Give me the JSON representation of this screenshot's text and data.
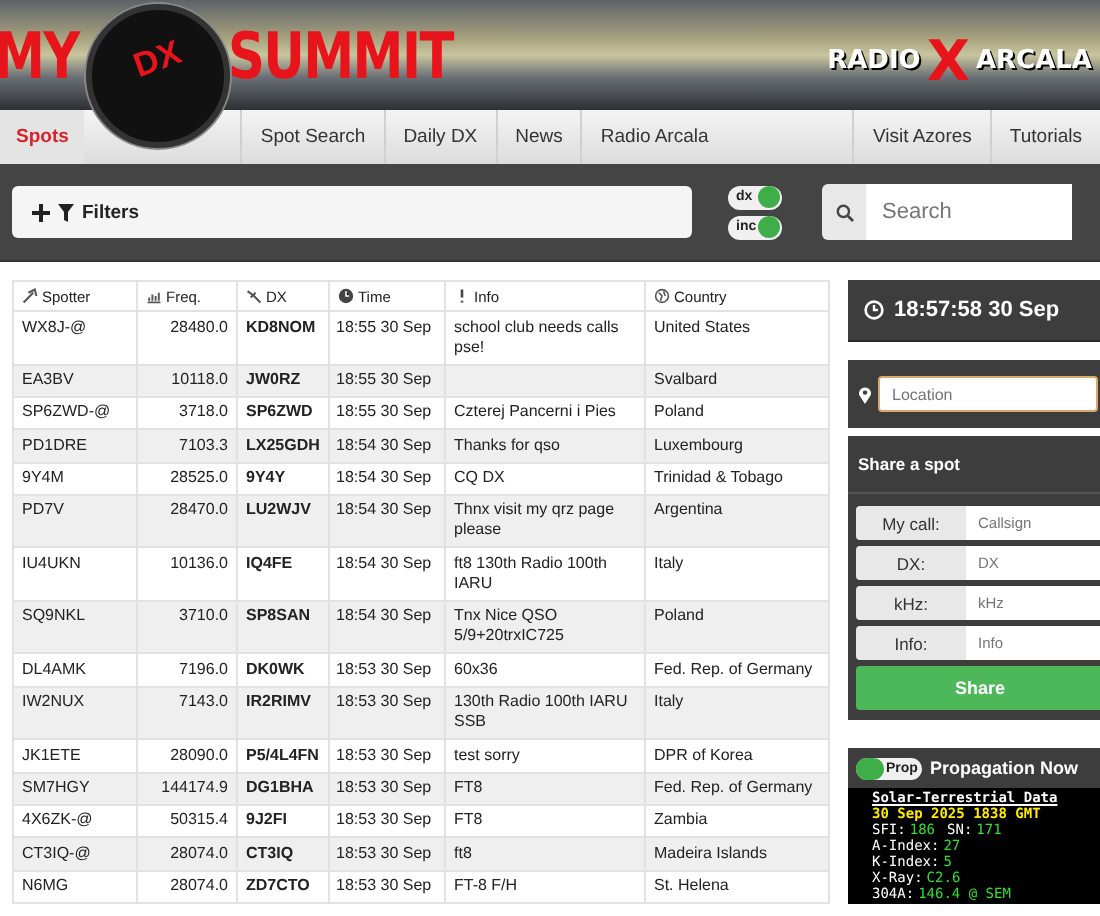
{
  "banner": {
    "logo_left": "MY",
    "logo_badge": "DX",
    "logo_right": "SUMMIT",
    "brand_left": "RADIO",
    "brand_mark": "X",
    "brand_right": "ARCALA"
  },
  "nav_left": [
    {
      "label": "Spots",
      "selected": true
    },
    {
      "label": "Spot Search",
      "selected": false
    },
    {
      "label": "Daily DX",
      "selected": false
    },
    {
      "label": "News",
      "selected": false
    },
    {
      "label": "Radio Arcala",
      "selected": false
    }
  ],
  "nav_right": [
    {
      "label": "Visit Azores",
      "selected": false
    },
    {
      "label": "Tutorials",
      "selected": false
    }
  ],
  "filters": {
    "label": "Filters"
  },
  "toggles": [
    {
      "label": "dx",
      "on": true
    },
    {
      "label": "inc",
      "on": true
    }
  ],
  "search": {
    "placeholder": "Search"
  },
  "table": {
    "columns": [
      "Spotter",
      "Freq.",
      "DX",
      "Time",
      "Info",
      "Country"
    ],
    "rows": [
      [
        "WX8J-@",
        "28480.0",
        "KD8NOM",
        "18:55 30 Sep",
        "school club needs calls pse!",
        "United States"
      ],
      [
        "EA3BV",
        "10118.0",
        "JW0RZ",
        "18:55 30 Sep",
        "",
        "Svalbard"
      ],
      [
        "SP6ZWD-@",
        "3718.0",
        "SP6ZWD",
        "18:55 30 Sep",
        "Czterej Pancerni i Pies",
        "Poland"
      ],
      [
        "PD1DRE",
        "7103.3",
        "LX25GDH",
        "18:54 30 Sep",
        "Thanks for qso",
        "Luxembourg"
      ],
      [
        "9Y4M",
        "28525.0",
        "9Y4Y",
        "18:54 30 Sep",
        "CQ DX",
        "Trinidad & Tobago"
      ],
      [
        "PD7V",
        "28470.0",
        "LU2WJV",
        "18:54 30 Sep",
        "Thnx visit my qrz page please",
        "Argentina"
      ],
      [
        "IU4UKN",
        "10136.0",
        "IQ4FE",
        "18:54 30 Sep",
        "ft8 130th Radio 100th IARU",
        "Italy"
      ],
      [
        "SQ9NKL",
        "3710.0",
        "SP8SAN",
        "18:54 30 Sep",
        "Tnx Nice QSO 5/9+20trxIC725",
        "Poland"
      ],
      [
        "DL4AMK",
        "7196.0",
        "DK0WK",
        "18:53 30 Sep",
        "60x36",
        "Fed. Rep. of Germany"
      ],
      [
        "IW2NUX",
        "7143.0",
        "IR2RIMV",
        "18:53 30 Sep",
        "130th Radio 100th IARU SSB",
        "Italy"
      ],
      [
        "JK1ETE",
        "28090.0",
        "P5/4L4FN",
        "18:53 30 Sep",
        "test sorry",
        "DPR of Korea"
      ],
      [
        "SM7HGY",
        "144174.9",
        "DG1BHA",
        "18:53 30 Sep",
        "FT8",
        "Fed. Rep. of Germany"
      ],
      [
        "4X6ZK-@",
        "50315.4",
        "9J2FI",
        "18:53 30 Sep",
        "FT8",
        "Zambia"
      ],
      [
        "CT3IQ-@",
        "28074.0",
        "CT3IQ",
        "18:53 30 Sep",
        "ft8",
        "Madeira Islands"
      ],
      [
        "N6MG",
        "28074.0",
        "ZD7CTO",
        "18:53 30 Sep",
        "FT-8 F/H",
        "St. Helena"
      ]
    ]
  },
  "clock": "18:57:58 30 Sep",
  "location": {
    "placeholder": "Location"
  },
  "share": {
    "title": "Share a spot",
    "fields": [
      {
        "label": "My call:",
        "placeholder": "Callsign"
      },
      {
        "label": "DX:",
        "placeholder": "DX"
      },
      {
        "label": "kHz:",
        "placeholder": "kHz"
      },
      {
        "label": "Info:",
        "placeholder": "Info"
      }
    ],
    "button": "Share"
  },
  "propagation": {
    "toggle": {
      "label": "Prop",
      "on": true
    },
    "title": "Propagation Now",
    "lines": [
      {
        "kind": "title",
        "parts": [
          {
            "label": "Solar-Terrestrial Data"
          }
        ]
      },
      {
        "kind": "date",
        "parts": [
          {
            "label": "30 Sep 2025 1838 GMT"
          }
        ]
      },
      {
        "kind": "pairs",
        "parts": [
          {
            "label": "SFI:",
            "value": "186"
          },
          {
            "label": "SN:",
            "value": "171"
          }
        ]
      },
      {
        "kind": "pairs",
        "parts": [
          {
            "label": "A-Index:",
            "value": "27"
          }
        ]
      },
      {
        "kind": "pairs",
        "parts": [
          {
            "label": "K-Index:",
            "value": "5"
          }
        ]
      },
      {
        "kind": "pairs",
        "parts": [
          {
            "label": "X-Ray:",
            "value": "C2.6"
          }
        ]
      },
      {
        "kind": "pairs",
        "parts": [
          {
            "label": "304A:",
            "value": "146.4 @ SEM"
          }
        ]
      }
    ]
  }
}
